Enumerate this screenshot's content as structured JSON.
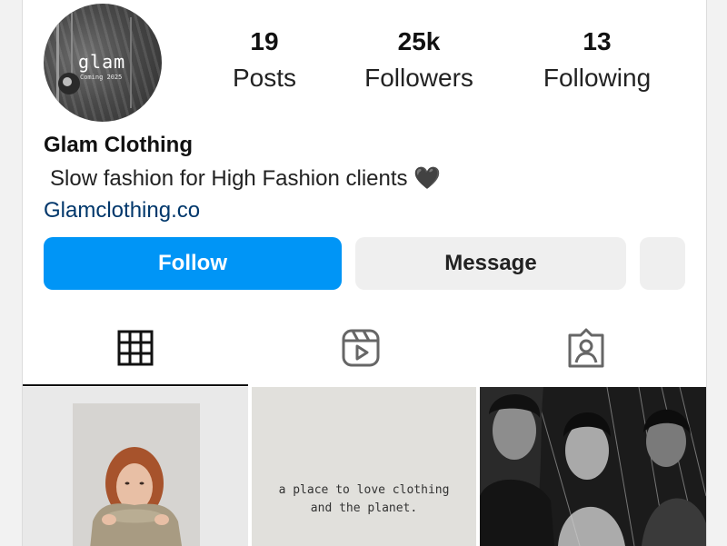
{
  "profile": {
    "avatar": {
      "title": "glam",
      "subtitle": "Coming 2025"
    },
    "stats": [
      {
        "value": "19",
        "label": "Posts"
      },
      {
        "value": "25k",
        "label": "Followers"
      },
      {
        "value": "13",
        "label": "Following"
      }
    ],
    "name": "Glam Clothing",
    "bio": "Slow fashion for High Fashion clients 🖤",
    "link": "Glamclothing.co"
  },
  "actions": {
    "follow_label": "Follow",
    "message_label": "Message"
  },
  "tabs": {
    "icons": [
      "grid-icon",
      "reels-icon",
      "tagged-icon"
    ],
    "active": "grid"
  },
  "grid": {
    "post2_lines": [
      "a place to love clothing",
      "and the planet."
    ]
  },
  "colors": {
    "accent": "#0095f6",
    "link": "#00376b",
    "button_secondary": "#efefef"
  }
}
